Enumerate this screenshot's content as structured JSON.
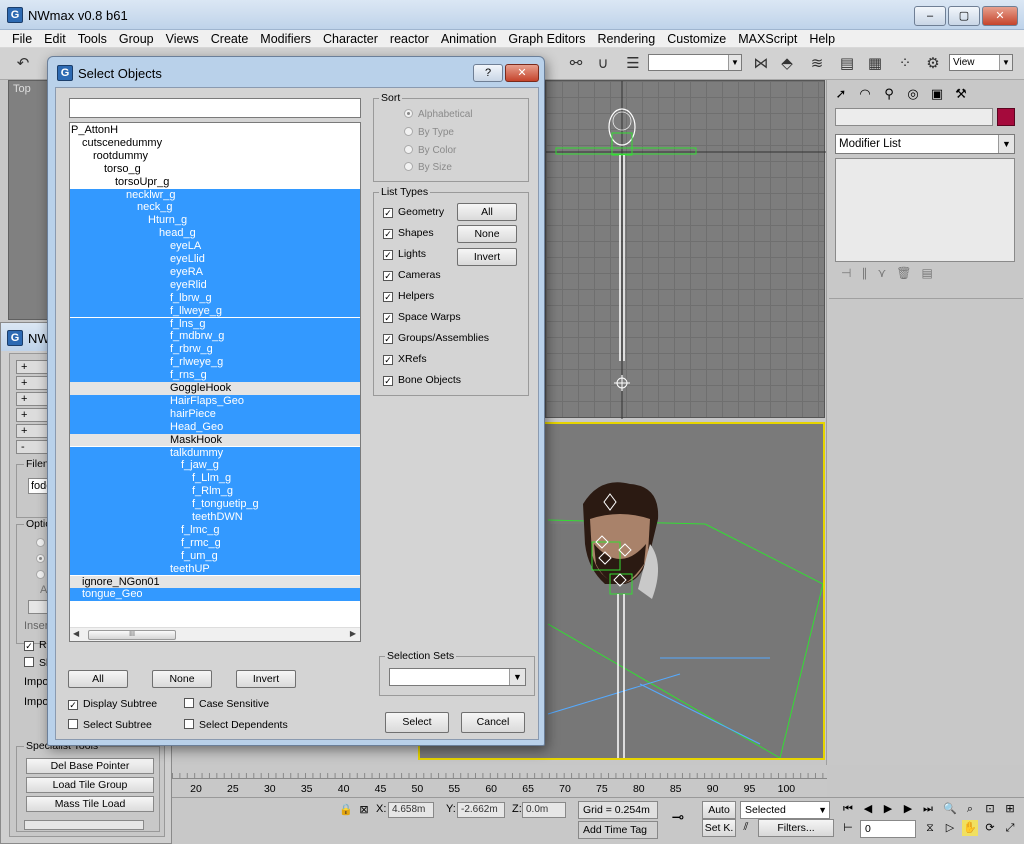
{
  "app": {
    "title": "NWmax v0.8 b61",
    "window_buttons": [
      "–",
      "▢",
      "✕"
    ]
  },
  "menu": [
    "File",
    "Edit",
    "Tools",
    "Group",
    "Views",
    "Create",
    "Modifiers",
    "Character",
    "reactor",
    "Animation",
    "Graph Editors",
    "Rendering",
    "Customize",
    "MAXScript",
    "Help"
  ],
  "toolbar": {
    "view_combo": "View"
  },
  "viewports": {
    "top_label": "Top"
  },
  "command_panel": {
    "modifier_list": "Modifier List",
    "object_color": "#a50a3c"
  },
  "nw_panel": {
    "title": "NW",
    "rollouts": [
      "+",
      "+",
      "+",
      "+",
      "+",
      "-"
    ],
    "filename_label": "Filena",
    "filename_value": "fodel",
    "options_label": "Option",
    "option_text": "A",
    "insert_label": "Insert",
    "checkbox1": "Re",
    "checkbox2": "Sh",
    "import1": "Impo",
    "import2": "Impor",
    "specialist_label": "Specialist Tools",
    "btn_del_base": "Del Base Pointer",
    "btn_load_tile": "Load Tile Group",
    "btn_mass_tile": "Mass Tile Load"
  },
  "dialog": {
    "title": "Select Objects",
    "help_btn": "?",
    "close_btn": "✕",
    "filter_value": "",
    "objects": [
      {
        "name": "P_AttonH",
        "level": 0,
        "state": "none"
      },
      {
        "name": "cutscenedummy",
        "level": 1,
        "state": "none"
      },
      {
        "name": "rootdummy",
        "level": 2,
        "state": "none"
      },
      {
        "name": "torso_g",
        "level": 3,
        "state": "none"
      },
      {
        "name": "torsoUpr_g",
        "level": 4,
        "state": "none"
      },
      {
        "name": "necklwr_g",
        "level": 5,
        "state": "sel"
      },
      {
        "name": "neck_g",
        "level": 6,
        "state": "sel"
      },
      {
        "name": "Hturn_g",
        "level": 7,
        "state": "sel"
      },
      {
        "name": "head_g",
        "level": 8,
        "state": "sel"
      },
      {
        "name": "eyeLA",
        "level": 9,
        "state": "sel"
      },
      {
        "name": "eyeLlid",
        "level": 9,
        "state": "sel"
      },
      {
        "name": "eyeRA",
        "level": 9,
        "state": "sel"
      },
      {
        "name": "eyeRlid",
        "level": 9,
        "state": "sel"
      },
      {
        "name": "f_lbrw_g",
        "level": 9,
        "state": "sel"
      },
      {
        "name": "f_llweye_g",
        "level": 9,
        "state": "sel"
      },
      {
        "name": "f_lns_g",
        "level": 9,
        "state": "sel"
      },
      {
        "name": "f_mdbrw_g",
        "level": 9,
        "state": "sel"
      },
      {
        "name": "f_rbrw_g",
        "level": 9,
        "state": "sel"
      },
      {
        "name": "f_rlweye_g",
        "level": 9,
        "state": "sel"
      },
      {
        "name": "f_rns_g",
        "level": 9,
        "state": "sel"
      },
      {
        "name": "GoggleHook",
        "level": 9,
        "state": "gray"
      },
      {
        "name": "HairFlaps_Geo",
        "level": 9,
        "state": "sel"
      },
      {
        "name": "hairPiece",
        "level": 9,
        "state": "sel"
      },
      {
        "name": "Head_Geo",
        "level": 9,
        "state": "sel"
      },
      {
        "name": "MaskHook",
        "level": 9,
        "state": "gray"
      },
      {
        "name": "talkdummy",
        "level": 9,
        "state": "sel"
      },
      {
        "name": "f_jaw_g",
        "level": 10,
        "state": "sel"
      },
      {
        "name": "f_Llm_g",
        "level": 11,
        "state": "sel"
      },
      {
        "name": "f_Rlm_g",
        "level": 11,
        "state": "sel"
      },
      {
        "name": "f_tonguetip_g",
        "level": 11,
        "state": "sel"
      },
      {
        "name": "teethDWN",
        "level": 11,
        "state": "sel"
      },
      {
        "name": "f_lmc_g",
        "level": 10,
        "state": "sel"
      },
      {
        "name": "f_rmc_g",
        "level": 10,
        "state": "sel"
      },
      {
        "name": "f_um_g",
        "level": 10,
        "state": "sel"
      },
      {
        "name": "teethUP",
        "level": 9,
        "state": "sel"
      },
      {
        "name": "ignore_NGon01",
        "level": 1,
        "state": "gray"
      },
      {
        "name": "tongue_Geo",
        "level": 1,
        "state": "sel"
      }
    ],
    "scroll_thumb": "III",
    "sort": {
      "label": "Sort",
      "options": [
        "Alphabetical",
        "By Type",
        "By Color",
        "By Size"
      ],
      "selected": "Alphabetical"
    },
    "list_types": {
      "label": "List Types",
      "items": [
        "Geometry",
        "Shapes",
        "Lights",
        "Cameras",
        "Helpers",
        "Space Warps",
        "Groups/Assemblies",
        "XRefs",
        "Bone Objects"
      ],
      "buttons": [
        "All",
        "None",
        "Invert"
      ]
    },
    "bottom_buttons": [
      "All",
      "None",
      "Invert"
    ],
    "options": {
      "display_subtree": "Display Subtree",
      "case_sensitive": "Case Sensitive",
      "select_subtree": "Select Subtree",
      "select_dependents": "Select Dependents"
    },
    "selection_sets_label": "Selection Sets",
    "select_btn": "Select",
    "cancel_btn": "Cancel"
  },
  "timeline": {
    "ticks": [
      "20",
      "25",
      "30",
      "35",
      "40",
      "45",
      "50",
      "55",
      "60",
      "65",
      "70",
      "75",
      "80",
      "85",
      "90",
      "95",
      "100"
    ]
  },
  "status": {
    "x_label": "X:",
    "x_value": "4.658m",
    "y_label": "Y:",
    "y_value": "-2.662m",
    "z_label": "Z:",
    "z_value": "0.0m",
    "grid": "Grid = 0.254m",
    "add_time_tag": "Add Time Tag",
    "auto": "Auto",
    "set_k": "Set K.",
    "selected_combo": "Selected",
    "filters": "Filters...",
    "frame_value": "0"
  }
}
